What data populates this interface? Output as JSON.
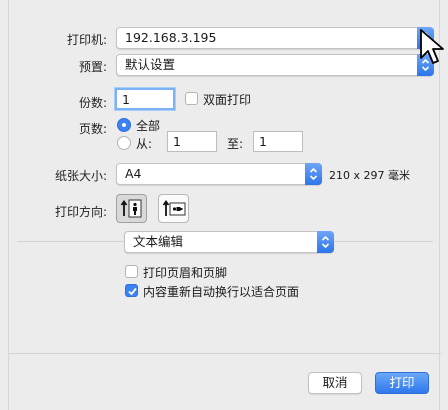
{
  "printer": {
    "label": "打印机:",
    "value": "192.168.3.195"
  },
  "preset": {
    "label": "预置:",
    "value": "默认设置"
  },
  "copies": {
    "label": "份数:",
    "value": "1",
    "duplex_label": "双面打印",
    "duplex_checked": false
  },
  "pages": {
    "label": "页数:",
    "all_label": "全部",
    "from_label": "从:",
    "from_value": "1",
    "to_label": "至:",
    "to_value": "1",
    "selected": "all"
  },
  "paper": {
    "label": "纸张大小:",
    "value": "A4",
    "dimensions": "210 x 297 毫米"
  },
  "orientation": {
    "label": "打印方向:",
    "selected": "portrait"
  },
  "section": {
    "value": "文本编辑"
  },
  "options": [
    {
      "label": "打印页眉和页脚",
      "checked": false
    },
    {
      "label": "内容重新自动换行以适合页面",
      "checked": true
    }
  ],
  "buttons": {
    "cancel": "取消",
    "print": "打印"
  },
  "colors": {
    "accent": "#3b82f6",
    "background": "#ececec"
  }
}
